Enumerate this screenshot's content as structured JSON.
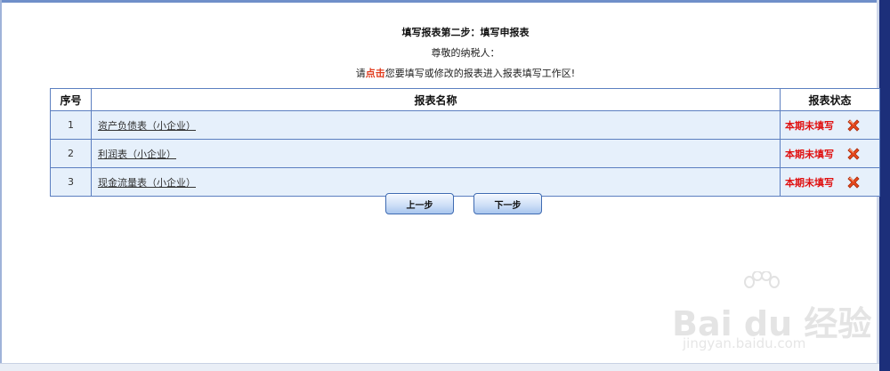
{
  "header": {
    "title": "填写报表第二步：填写申报表",
    "greeting": "尊敬的纳税人：",
    "instruction_prefix": "请",
    "instruction_highlight": "点击",
    "instruction_suffix": "您要填写或修改的报表进入报表填写工作区!"
  },
  "table": {
    "columns": [
      "序号",
      "报表名称",
      "报表状态"
    ],
    "rows": [
      {
        "index": "1",
        "name": "资产负债表（小企业）",
        "status": "本期未填写"
      },
      {
        "index": "2",
        "name": "利润表（小企业）",
        "status": "本期未填写"
      },
      {
        "index": "3",
        "name": "现金流量表（小企业）",
        "status": "本期未填写"
      }
    ]
  },
  "buttons": {
    "prev": "上一步",
    "next": "下一步"
  },
  "watermark": {
    "logo": "Bai du 经验",
    "url": "jingyan.baidu.com"
  },
  "colors": {
    "highlight": "#e13b1d",
    "status": "#e01010",
    "border": "#5c7fc0",
    "row_bg": "#e6f0fb"
  }
}
